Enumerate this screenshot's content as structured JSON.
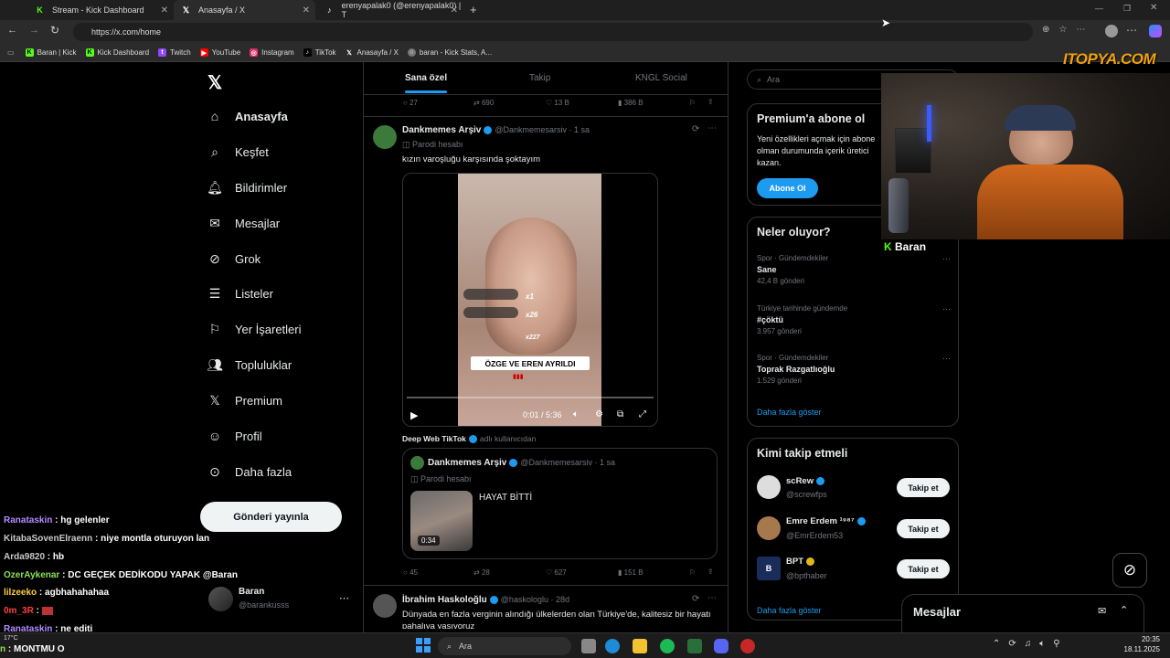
{
  "browser": {
    "tabs": [
      {
        "label": "Stream - Kick Dashboard",
        "icon": "kick-icon"
      },
      {
        "label": "Anasayfa / X",
        "icon": "x-icon"
      },
      {
        "label": "erenyapalak0 (@erenyapalak0) | T",
        "icon": "tiktok-icon"
      }
    ],
    "url": "https://x.com/home",
    "bookmarks": [
      "Baran | Kick",
      "Kick Dashboard",
      "Twitch",
      "YouTube",
      "Instagram",
      "TikTok",
      "Anasayfa / X",
      "baran - Kick Stats, A..."
    ]
  },
  "sidebar": {
    "items": [
      {
        "label": "Anasayfa",
        "icon": "home-icon"
      },
      {
        "label": "Keşfet",
        "icon": "search-icon"
      },
      {
        "label": "Bildirimler",
        "icon": "bell-icon"
      },
      {
        "label": "Mesajlar",
        "icon": "mail-icon"
      },
      {
        "label": "Grok",
        "icon": "grok-icon"
      },
      {
        "label": "Listeler",
        "icon": "list-icon"
      },
      {
        "label": "Yer İşaretleri",
        "icon": "bookmark-icon"
      },
      {
        "label": "Topluluklar",
        "icon": "community-icon"
      },
      {
        "label": "Premium",
        "icon": "x-icon"
      },
      {
        "label": "Profil",
        "icon": "person-icon"
      },
      {
        "label": "Daha fazla",
        "icon": "more-icon"
      }
    ],
    "post_button": "Gönderi yayınla",
    "account": {
      "name": "Baran",
      "handle": "@barankusss"
    }
  },
  "timeline": {
    "tabs": [
      "Sana özel",
      "Takip",
      "KNGL Social"
    ],
    "top_actions": {
      "replies": "27",
      "reposts": "690",
      "likes": "13 B",
      "views": "386 B"
    },
    "post1": {
      "name": "Dankmemes Arşiv",
      "handle": "@Dankmemesarsiv",
      "time": "1 sa",
      "sub": "Parodi hesabı",
      "text": "kızın varoşluğu karşısında şoktayım",
      "video_caption": "ÖZGE VE EREN AYRILDI",
      "video_time": "0:01 / 5:36",
      "overlay_counts": [
        "x1",
        "x26",
        "x227"
      ]
    },
    "source": "Deep Web TikTok",
    "source_suffix": "adlı kullanıcıdan",
    "quote": {
      "name": "Dankmemes Arşiv",
      "handle": "@Dankmemesarsiv",
      "time": "1 sa",
      "sub": "Parodi hesabı",
      "text": "HAYAT BİTTİ",
      "duration": "0:34"
    },
    "post1_actions": {
      "replies": "45",
      "reposts": "28",
      "likes": "627",
      "views": "151 B"
    },
    "post2": {
      "name": "İbrahim Haskoloğlu",
      "handle": "@haskologlu",
      "time": "28d",
      "text": "Dünyada en fazla verginin alındığı ülkelerden olan Türkiye'de, kalitesiz bir hayatı pahalıya yaşıyoruz"
    }
  },
  "right": {
    "search_placeholder": "Ara",
    "premium": {
      "title": "Premium'a abone ol",
      "text": "Yeni özellikleri açmak için abonе olman durumunda içerik üretici kazan.",
      "button": "Abone Ol"
    },
    "trends": {
      "title": "Neler oluyor?",
      "items": [
        {
          "meta": "Spor · Gündemdekiler",
          "topic": "Sane",
          "count": "42,4 B gönderi"
        },
        {
          "meta": "Türkiye tarihinde gündemde",
          "topic": "#çöktü",
          "count": "3.957 gönderi"
        },
        {
          "meta": "Spor · Gündemdekiler",
          "topic": "Toprak Razgatlıoğlu",
          "count": "1.529 gönderi"
        }
      ],
      "more": "Daha fazla göster"
    },
    "who_to_follow": {
      "title": "Kimi takip etmeli",
      "items": [
        {
          "name": "scRew",
          "handle": "@screwfps",
          "button": "Takip et"
        },
        {
          "name": "Emre Erdem ¹⁹⁸⁷",
          "handle": "@EmrErdem53",
          "button": "Takip et"
        },
        {
          "name": "BPT",
          "handle": "@bpthaber",
          "button": "Takip et"
        }
      ],
      "more": "Daha fazla göster"
    },
    "messages": "Mesajlar"
  },
  "overlay": {
    "logo": "ITOPYA.COM",
    "streamer_tag": "Baran"
  },
  "chat": [
    {
      "user": "Ranataskin",
      "msg": "hg gelenler",
      "color": "#b48cff"
    },
    {
      "user": "KitabaSovenElraenn",
      "msg": "niye montla oturuyon lan",
      "color": "#c8c8c8"
    },
    {
      "user": "Arda9820",
      "msg": "hb",
      "color": "#c8c8c8"
    },
    {
      "user": "OzerAykenar",
      "msg": "DC GEÇEK DEDİKODU YAPAK @Baran",
      "color": "#8fe05a"
    },
    {
      "user": "lilzeeko",
      "msg": "agbhahahahaa",
      "color": "#ffcf40"
    },
    {
      "user": "0m_3R",
      "msg": "",
      "color": "#ff4040"
    },
    {
      "user": "Ranataskin",
      "msg": "ne editi",
      "color": "#b48cff"
    },
    {
      "user": "n",
      "msg": "MONTMU O",
      "color": "#8fe05a"
    }
  ],
  "taskbar": {
    "search": "Ara",
    "time": "20:35",
    "date": "18.11.2025",
    "weather": "17°C"
  }
}
